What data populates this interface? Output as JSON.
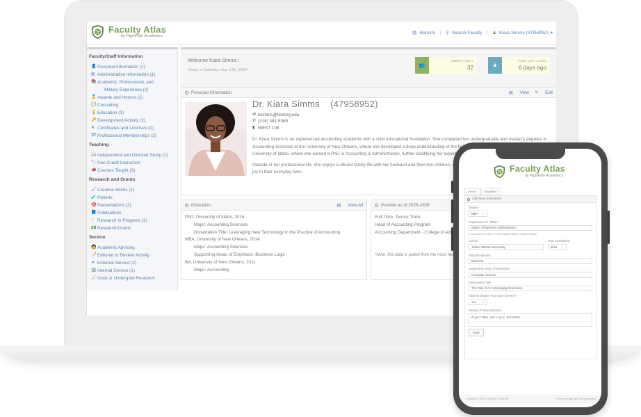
{
  "brand": {
    "title": "Faculty Atlas",
    "subtitle": "by FlightPath Academics",
    "accent": "#7aa35b",
    "link_color": "#5a7fb3"
  },
  "header_nav": [
    {
      "icon": "reports-icon",
      "glyph": "▤",
      "label": "Reports"
    },
    {
      "icon": "search-icon",
      "glyph": "⚲",
      "label": "Search Faculty"
    },
    {
      "icon": "user-icon",
      "glyph": "♟",
      "label": "Kiara Simms (47958952) ▾"
    }
  ],
  "sidebar": {
    "groups": [
      {
        "heading": "Faculty/Staff Information",
        "items": [
          {
            "icon": "person-icon",
            "glyph": "👤",
            "label": "Personal Information (1)"
          },
          {
            "icon": "id-card-icon",
            "glyph": "▤",
            "label": "Administrative Information (1)"
          },
          {
            "icon": "books-icon",
            "glyph": "📚",
            "label": "Academic, Professional, and"
          },
          {
            "icon": "",
            "glyph": "",
            "label": "Military Experience (2)",
            "indent": true
          },
          {
            "icon": "award-icon",
            "glyph": "🏅",
            "label": "Awards and Honors (2)"
          },
          {
            "icon": "chat-icon",
            "glyph": "💬",
            "label": "Consulting"
          },
          {
            "icon": "lightbulb-icon",
            "glyph": "💡",
            "label": "Education (3)"
          },
          {
            "icon": "key-icon",
            "glyph": "🔑",
            "label": "Development Activity (2)"
          },
          {
            "icon": "star-icon",
            "glyph": "★",
            "label": "Certificates and Licenses (1)"
          },
          {
            "icon": "membership-icon",
            "glyph": "🪪",
            "label": "Professional Memberships (2)"
          }
        ]
      },
      {
        "heading": "Teaching",
        "items": [
          {
            "icon": "book-open-icon",
            "glyph": "📖",
            "label": "Independent and Directed Study (1)"
          },
          {
            "icon": "tag-icon",
            "glyph": "🏷",
            "label": "Non-Credit Instruction"
          },
          {
            "icon": "megaphone-icon",
            "glyph": "📣",
            "label": "Courses Taught (3)"
          }
        ]
      },
      {
        "heading": "Research and Grants",
        "items": [
          {
            "icon": "brush-icon",
            "glyph": "🖌",
            "label": "Creative Works (1)"
          },
          {
            "icon": "patent-icon",
            "glyph": "🧪",
            "label": "Patents"
          },
          {
            "icon": "presentation-icon",
            "glyph": "🎯",
            "label": "Presentations (2)"
          },
          {
            "icon": "publication-icon",
            "glyph": "📘",
            "label": "Publications"
          },
          {
            "icon": "lightning-icon",
            "glyph": "⚡",
            "label": "Research In Progress (1)"
          },
          {
            "icon": "grant-icon",
            "glyph": "💵",
            "label": "Research/Grants"
          }
        ]
      },
      {
        "heading": "Service",
        "items": [
          {
            "icon": "advising-icon",
            "glyph": "🧑",
            "label": "Academic Advising"
          },
          {
            "icon": "editorial-icon",
            "glyph": "📝",
            "label": "Editorial or Review Activity"
          },
          {
            "icon": "arrow-right-icon",
            "glyph": "➜",
            "label": "External Service (2)"
          },
          {
            "icon": "building-icon",
            "glyph": "🏢",
            "label": "Internal Service (1)"
          },
          {
            "icon": "graph-icon",
            "glyph": "📈",
            "label": "Grad or Undergrad Research"
          }
        ]
      }
    ]
  },
  "welcome": {
    "title": "Welcome Kiara Simms !",
    "date": "Today is Saturday, Aug 10th, 2024",
    "stats": [
      {
        "label": "Users Today",
        "value": "32",
        "color": "#8fb260",
        "glyph": "👥"
      },
      {
        "label": "Your Last Login",
        "value": "6 days ago",
        "color": "#6aaabc",
        "glyph": "♟"
      }
    ]
  },
  "personal_info": {
    "panel_title": "Personal Information",
    "view_label": "View",
    "edit_label": "Edit",
    "name": "Dr. Kiara Simms",
    "id": "(47958952)",
    "email": "ksimms@testorg.edu",
    "phone": "(318) 381-5369",
    "office": "WEST 108",
    "bio": [
      "Dr. Kiara Simms is an experienced accounting academic with a solid educational foundation. She completed her undergraduate and master's degrees in Accounting Sciences at the University of New Orleans, where she developed a deep understanding of the field. Her pursuit of knowledge led her to the University of Idaho, where she earned a PhD in Accounting & Administration, further solidifying her expertise through research and dedication to teaching.",
      "Outside of her professional life, she enjoys a vibrant family life with her husband and their two children, accompanied by their beloved dog, Barkly, who adds joy to their everyday lives."
    ]
  },
  "education": {
    "panel_title": "Education",
    "view_all_label": "View All",
    "lines": [
      {
        "text": "PhD, University of Idaho, 2016.",
        "indent": false
      },
      {
        "text": "Major: Accounting Sciences",
        "indent": true
      },
      {
        "text": "Dissertation Title: Leveraging New Technology in the Practice of Accounting",
        "indent": true
      },
      {
        "text": "MBA, University of New Orleans, 2014.",
        "indent": false
      },
      {
        "text": "Major: Accounting Sciences",
        "indent": true
      },
      {
        "text": "Supporting Areas of Emphasis: Business Logic",
        "indent": true
      },
      {
        "text": "BA, University of New Orleans, 2011.",
        "indent": false
      },
      {
        "text": "Major: Accounting",
        "indent": true
      }
    ]
  },
  "position": {
    "panel_title": "Position as of 2025-2026",
    "lines": [
      "Full-Time, Tenure Track",
      "Head of Accounting Program",
      "Accounting Department - College of Administration"
    ],
    "note": "*Note: this data is pulled from the most recent employment record."
  },
  "mobile": {
    "breadcrumb": [
      "Home",
      "Education"
    ],
    "panel_title": "Add New Education",
    "form": {
      "degree_label": "Degree",
      "degree_value": "MBA",
      "other_label": "Explanation of \"Other\"",
      "other_value": "Master of Business Administration",
      "other_help": "If you selected \"other\" in the selection above, please explain",
      "school_label": "School",
      "school_value": "Tucker Witman University",
      "year_label": "Year Completed",
      "year_value": "2021",
      "major_label": "Major/Emphasis",
      "major_value": "Business",
      "support_label": "Supporting Areas of Emphasis",
      "support_value": "Computer Science",
      "dissertation_label": "Dissertation Title",
      "dissertation_value": "The Role of AI in Emerging Economies",
      "highest_label": "Highest Degree You Have Earned?",
      "highest_value": "Yes",
      "specialization_label": "Area(s) of Specialization",
      "specialization_value": "Algorithms and Logic Automata",
      "save_label": "Save"
    },
    "footer_left": "Copyright © 2024. All Rights Reserved",
    "footer_right": "Powered by ◀ FlightPath Academics"
  }
}
